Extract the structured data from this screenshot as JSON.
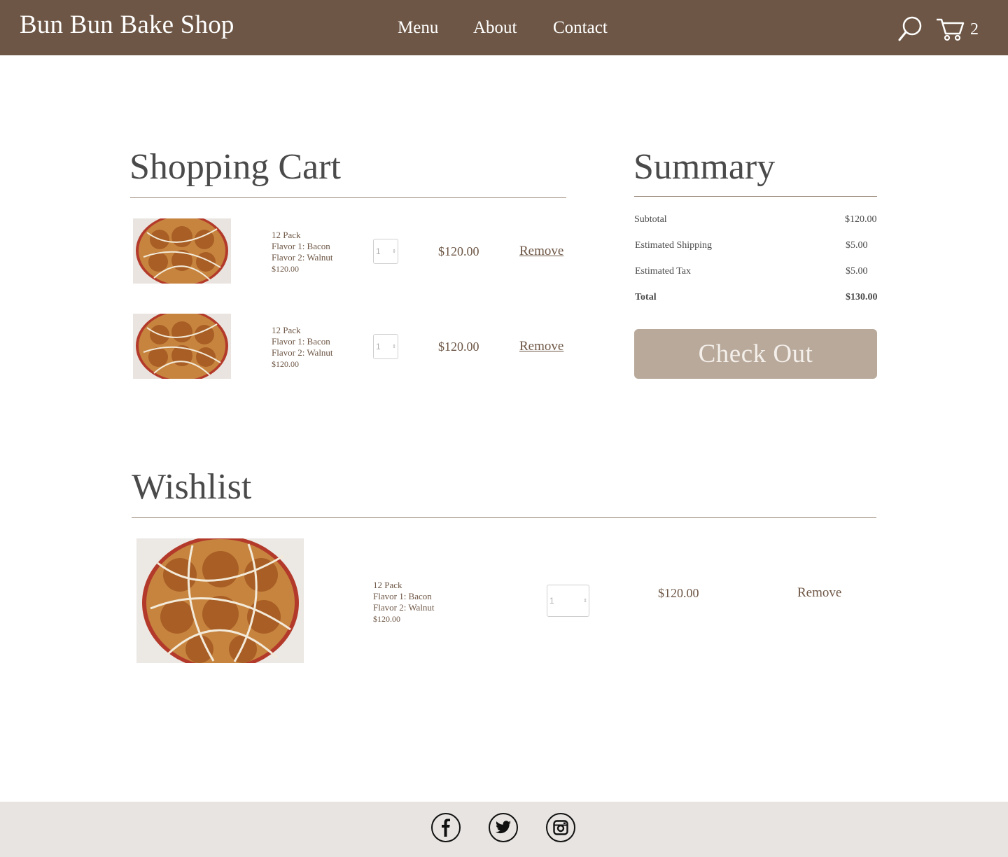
{
  "header": {
    "brand": "Bun Bun Bake Shop",
    "nav": [
      "Menu",
      "About",
      "Contact"
    ],
    "cart_count": "2",
    "icons": [
      "search-icon",
      "cart-icon"
    ]
  },
  "cart": {
    "title": "Shopping Cart",
    "items": [
      {
        "pack": "12 Pack",
        "flavor1": "Flavor 1: Bacon",
        "flavor2": "Flavor 2: Walnut",
        "unit_price": "$120.00",
        "quantity": "1",
        "line_price": "$120.00",
        "remove_label": "Remove"
      },
      {
        "pack": "12 Pack",
        "flavor1": "Flavor 1: Bacon",
        "flavor2": "Flavor 2: Walnut",
        "unit_price": "$120.00",
        "quantity": "1",
        "line_price": "$120.00",
        "remove_label": "Remove"
      }
    ]
  },
  "summary": {
    "title": "Summary",
    "rows": [
      {
        "label": "Subtotal",
        "value": "$120.00"
      },
      {
        "label": "Estimated Shipping",
        "value": "$5.00"
      },
      {
        "label": "Estimated Tax",
        "value": "$5.00"
      },
      {
        "label": "Total",
        "value": "$130.00"
      }
    ],
    "checkout_label": "Check Out"
  },
  "wishlist": {
    "title": "Wishlist",
    "items": [
      {
        "pack": "12 Pack",
        "flavor1": "Flavor 1: Bacon",
        "flavor2": "Flavor 2: Walnut",
        "unit_price": "$120.00",
        "quantity": "1",
        "line_price": "$120.00",
        "remove_label": "Remove"
      }
    ]
  },
  "footer": {
    "social": [
      "facebook-icon",
      "twitter-icon",
      "instagram-icon"
    ]
  },
  "colors": {
    "header_bg": "#6d5645",
    "checkout_bg": "#b8a99b",
    "footer_bg": "#e8e4e1",
    "accent_text": "#6d5645"
  }
}
